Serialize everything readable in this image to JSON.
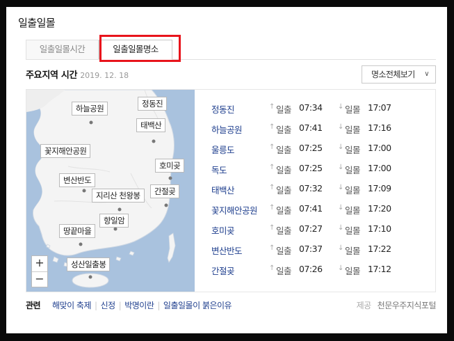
{
  "title": "일출일몰",
  "tabs": [
    {
      "label": "일출일몰시간"
    },
    {
      "label": "일출일몰명소"
    }
  ],
  "subhead": {
    "title": "주요지역 시간",
    "date": "2019. 12. 18"
  },
  "all_places_button": "명소전체보기",
  "map": {
    "labels": [
      "정동진",
      "하늘공원",
      "태백산",
      "꽃지해안공원",
      "호미곶",
      "변산반도",
      "간절곶",
      "지리산 천왕봉",
      "향일암",
      "땅끝마을",
      "성산일출봉"
    ],
    "zoom_in": "+",
    "zoom_out": "−",
    "colors": {
      "sea": "#a9c2de",
      "land": "#f4f4f4"
    }
  },
  "rise_label": "일출",
  "set_label": "일몰",
  "places": [
    {
      "name": "정동진",
      "rise": "07:34",
      "set": "17:07"
    },
    {
      "name": "하늘공원",
      "rise": "07:41",
      "set": "17:16"
    },
    {
      "name": "울릉도",
      "rise": "07:25",
      "set": "17:00"
    },
    {
      "name": "독도",
      "rise": "07:25",
      "set": "17:00"
    },
    {
      "name": "태백산",
      "rise": "07:32",
      "set": "17:09"
    },
    {
      "name": "꽃지해안공원",
      "rise": "07:41",
      "set": "17:20"
    },
    {
      "name": "호미곶",
      "rise": "07:27",
      "set": "17:10"
    },
    {
      "name": "변산반도",
      "rise": "07:37",
      "set": "17:22"
    },
    {
      "name": "간절곶",
      "rise": "07:26",
      "set": "17:12"
    }
  ],
  "footer": {
    "related_label": "관련",
    "links": [
      "해맞이 축제",
      "신정",
      "박명이란",
      "일출일몰이 붉은이유"
    ],
    "provider_label": "제공",
    "provider_name": "천문우주지식포털"
  },
  "colors": {
    "link": "#1f3f8e",
    "highlight": "#e8141c"
  }
}
